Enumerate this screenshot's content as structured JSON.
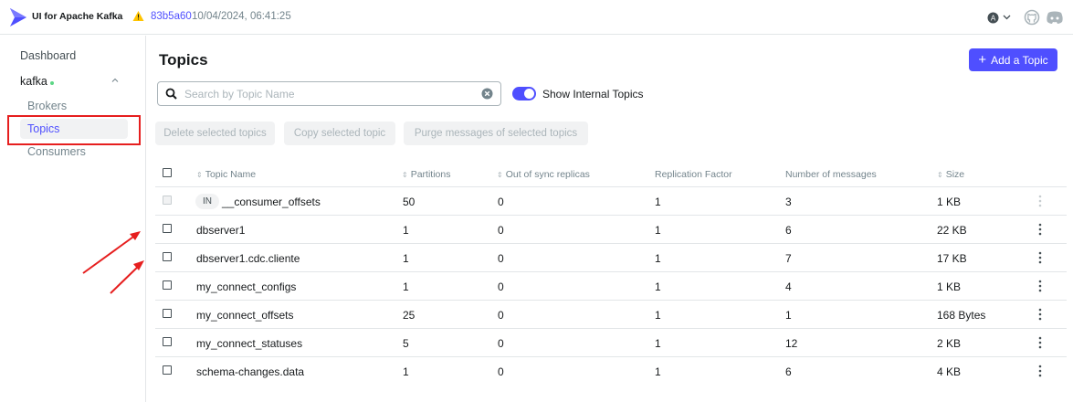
{
  "header": {
    "app_title": "UI for Apache Kafka",
    "commit_hash": "83b5a60",
    "commit_date": "10/04/2024, 06:41:25",
    "user_initial": "A"
  },
  "sidebar": {
    "dashboard": "Dashboard",
    "cluster": "kafka",
    "items": [
      {
        "label": "Brokers"
      },
      {
        "label": "Topics"
      },
      {
        "label": "Consumers"
      }
    ]
  },
  "main": {
    "title": "Topics",
    "add_button": "Add a Topic",
    "search_placeholder": "Search by Topic Name",
    "toggle_label": "Show Internal Topics",
    "batch_actions": [
      "Delete selected topics",
      "Copy selected topic",
      "Purge messages of selected topics"
    ]
  },
  "table": {
    "columns": [
      "Topic Name",
      "Partitions",
      "Out of sync replicas",
      "Replication Factor",
      "Number of messages",
      "Size"
    ],
    "rows": [
      {
        "internal_badge": "IN",
        "name": "__consumer_offsets",
        "partitions": "50",
        "out_of_sync": "0",
        "replication": "1",
        "messages": "3",
        "size": "1 KB"
      },
      {
        "name": "dbserver1",
        "partitions": "1",
        "out_of_sync": "0",
        "replication": "1",
        "messages": "6",
        "size": "22 KB"
      },
      {
        "name": "dbserver1.cdc.cliente",
        "partitions": "1",
        "out_of_sync": "0",
        "replication": "1",
        "messages": "7",
        "size": "17 KB"
      },
      {
        "name": "my_connect_configs",
        "partitions": "1",
        "out_of_sync": "0",
        "replication": "1",
        "messages": "4",
        "size": "1 KB"
      },
      {
        "name": "my_connect_offsets",
        "partitions": "25",
        "out_of_sync": "0",
        "replication": "1",
        "messages": "1",
        "size": "168 Bytes"
      },
      {
        "name": "my_connect_statuses",
        "partitions": "5",
        "out_of_sync": "0",
        "replication": "1",
        "messages": "12",
        "size": "2 KB"
      },
      {
        "name": "schema-changes.data",
        "partitions": "1",
        "out_of_sync": "0",
        "replication": "1",
        "messages": "6",
        "size": "4 KB"
      }
    ]
  },
  "colors": {
    "accent": "#4f4fff",
    "annotation": "#e61e1e",
    "warning": "#ffc400"
  }
}
